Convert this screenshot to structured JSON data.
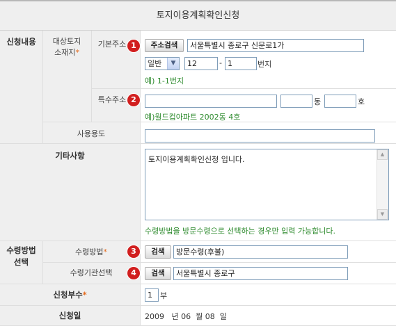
{
  "title": "토지이용계획확인신청",
  "sections": {
    "application": "신청내용",
    "target_land": "대상토지\n소재지",
    "receipt_method": "수령방법\n선택"
  },
  "labels": {
    "basic_address": "기본주소",
    "special_address": "특수주소",
    "usage": "사용용도",
    "other": "기타사항",
    "receipt_method": "수령방법",
    "receipt_office": "수령기관선택",
    "copies": "신청부수",
    "date": "신청일"
  },
  "required_mark": "*",
  "badges": [
    "1",
    "2",
    "3",
    "4"
  ],
  "basic_address": {
    "search_button": "주소검색",
    "address_value": "서울특별시 종로구 신문로1가",
    "type_select": "일반",
    "main_number": "12",
    "dash": "-",
    "sub_number": "1",
    "unit": "번지",
    "example": "예) 1-1번지"
  },
  "special_address": {
    "value": "",
    "dong_value": "",
    "dong_unit": "동",
    "ho_value": "",
    "ho_unit": "호",
    "example": "예)월드컵아파트 2002동 4호"
  },
  "usage_value": "",
  "other_value": "토지이용계획확인신청 입니다.",
  "other_note": "수령방법을 방문수령으로 선택하는 경우만 입력 가능합니다.",
  "receipt": {
    "search_button": "검색",
    "method_value": "방문수령(후불)",
    "office_value": "서울특별시 종로구"
  },
  "copies": {
    "value": "1",
    "unit": "부"
  },
  "date": {
    "year": "2009",
    "year_unit": "년",
    "month": "06",
    "month_unit": "월",
    "day": "08",
    "day_unit": "일"
  },
  "colors": {
    "required": "#e56a1c",
    "badge": "#d11e1e",
    "example_text": "#2e8b2e",
    "header_bg": "#efefef"
  }
}
